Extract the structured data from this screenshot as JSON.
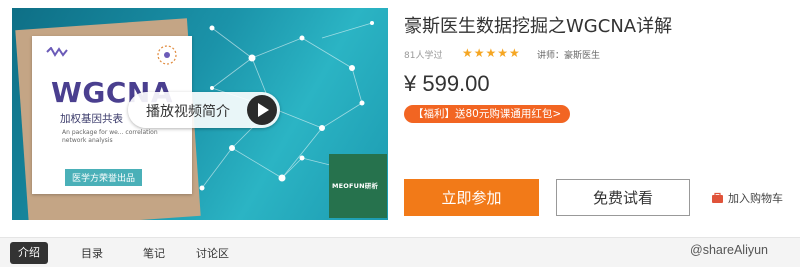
{
  "cover": {
    "title": "WGCNA",
    "subtitle_cn": "加权基因共表",
    "desc_en": "An package for we... correlation network analysis",
    "producer": "医学方荣誉出品",
    "play_label": "播放视频简介",
    "brand": "MEOFUN研析"
  },
  "course": {
    "title": "豪斯医生数据挖掘之WGCNA详解",
    "learners": "81人学过",
    "rating_stars": "★★★★★",
    "teacher": "讲师：豪斯医生",
    "price": "¥ 599.00",
    "promo": "【福利】送80元购课通用红包>"
  },
  "actions": {
    "join_label": "立即参加",
    "trial_label": "免费试看",
    "cart_label": "加入购物车"
  },
  "tabs": [
    {
      "label": "介绍"
    },
    {
      "label": "目录"
    },
    {
      "label": "笔记"
    },
    {
      "label": "讨论区"
    }
  ],
  "watermark": "@shareAliyun",
  "colors": {
    "accent_orange": "#f27a18",
    "promo_orange": "#f26522",
    "star": "#f5a623",
    "cover_teal": "#1b93a9"
  }
}
